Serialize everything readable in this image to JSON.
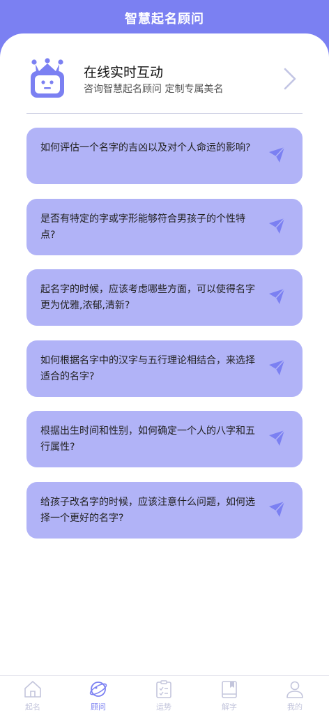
{
  "header": {
    "title": "智慧起名顾问"
  },
  "intro": {
    "title": "在线实时互动",
    "subtitle": "咨询智慧起名顾问 定制专属美名",
    "icon": "robot-icon"
  },
  "questions": [
    {
      "text": "如何评估一个名字的吉凶以及对个人命运的影响?"
    },
    {
      "text": "是否有特定的字或字形能够符合男孩子的个性特点?"
    },
    {
      "text": "起名字的时候，应该考虑哪些方面，可以使得名字更为优雅,浓郁,清新?"
    },
    {
      "text": "如何根据名字中的汉字与五行理论相结合，来选择适合的名字?"
    },
    {
      "text": "根据出生时间和性别，如何确定一个人的八字和五行属性?"
    },
    {
      "text": "给孩子改名字的时候，应该注意什么问题，如何选择一个更好的名字?"
    }
  ],
  "tabbar": {
    "items": [
      {
        "label": "起名",
        "icon": "home-icon"
      },
      {
        "label": "顾问",
        "icon": "planet-icon",
        "active": true
      },
      {
        "label": "运势",
        "icon": "clipboard-icon"
      },
      {
        "label": "解字",
        "icon": "book-icon"
      },
      {
        "label": "我的",
        "icon": "user-icon"
      }
    ]
  },
  "colors": {
    "accent": "#7b80f2",
    "card": "#b1b3f7",
    "tab_inactive": "#c3c5dc"
  }
}
